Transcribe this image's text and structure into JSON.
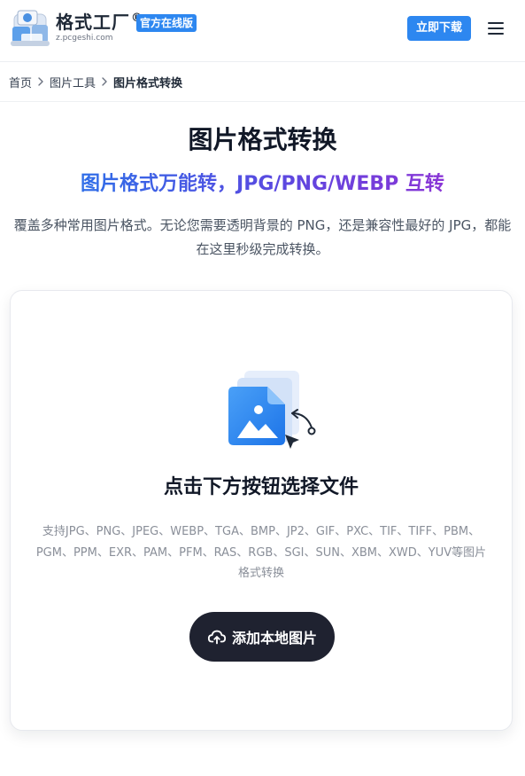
{
  "header": {
    "brand_name": "格式工厂",
    "brand_mark": "®",
    "official_badge": "官方在线版",
    "domain": "z.pcgeshi.com",
    "download_label": "立即下载"
  },
  "breadcrumb": {
    "items": [
      "首页",
      "图片工具",
      "图片格式转换"
    ]
  },
  "main": {
    "title": "图片格式转换",
    "subtitle": "图片格式万能转，JPG/PNG/WEBP 互转",
    "description": "覆盖多种常用图片格式。无论您需要透明背景的 PNG，还是兼容性最好的 JPG，都能在这里秒级完成转换。"
  },
  "upload": {
    "heading": "点击下方按钮选择文件",
    "formats_text": "支持JPG、PNG、JPEG、WEBP、TGA、BMP、JP2、GIF、PXC、TIF、TIFF、PBM、PGM、PPM、EXR、PAM、PFM、RAS、RGB、SGI、SUN、XBM、XWD、YUV等图片格式转换",
    "button_label": "添加本地图片"
  },
  "icons": {
    "logo": "app-logo-icon",
    "menu": "hamburger-menu-icon",
    "breadcrumb_separator": "chevron-right-icon",
    "upload_illustration": "image-file-icon",
    "upload_button": "cloud-upload-icon"
  },
  "colors": {
    "accent": "#2d87f0",
    "button_dark": "#1f2230",
    "gradient_start": "#2f6ee8",
    "gradient_end": "#8a35d6"
  }
}
